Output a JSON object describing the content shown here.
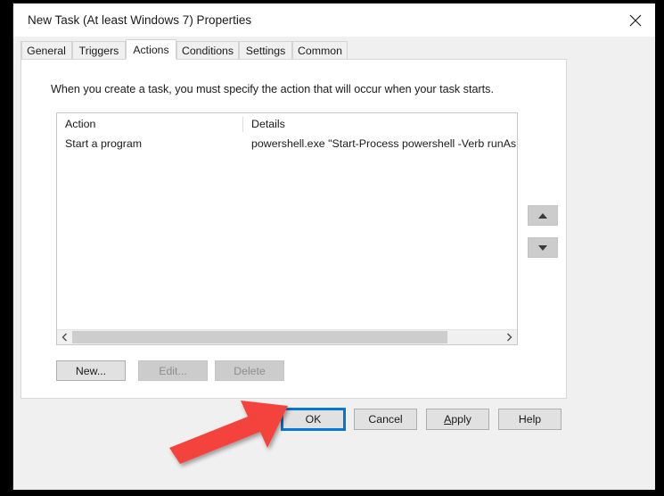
{
  "window": {
    "title": "New Task (At least Windows 7) Properties",
    "close_icon": "close-icon"
  },
  "tabs": [
    {
      "label": "General",
      "selected": false
    },
    {
      "label": "Triggers",
      "selected": false
    },
    {
      "label": "Actions",
      "selected": true
    },
    {
      "label": "Conditions",
      "selected": false
    },
    {
      "label": "Settings",
      "selected": false
    },
    {
      "label": "Common",
      "selected": false
    }
  ],
  "actions_panel": {
    "description": "When you create a task, you must specify the action that will occur when your task starts.",
    "columns": [
      "Action",
      "Details"
    ],
    "rows": [
      {
        "action": "Start a program",
        "details": "powershell.exe \"Start-Process powershell -Verb runAs -Argumen"
      }
    ],
    "move_up_icon": "arrow-up-icon",
    "move_down_icon": "arrow-down-icon",
    "scrollbar": {
      "left_arrow_icon": "chevron-left-icon",
      "right_arrow_icon": "chevron-right-icon"
    },
    "buttons": [
      {
        "label": "New...",
        "enabled": true
      },
      {
        "label": "Edit...",
        "enabled": false
      },
      {
        "label": "Delete",
        "enabled": false
      }
    ]
  },
  "footer": {
    "ok": "OK",
    "cancel": "Cancel",
    "apply_prefix": "",
    "apply_mnemonic": "A",
    "apply_suffix": "pply",
    "help": "Help"
  },
  "annotation": {
    "arrow_color": "#F4433C",
    "points_to": "ok-button"
  }
}
